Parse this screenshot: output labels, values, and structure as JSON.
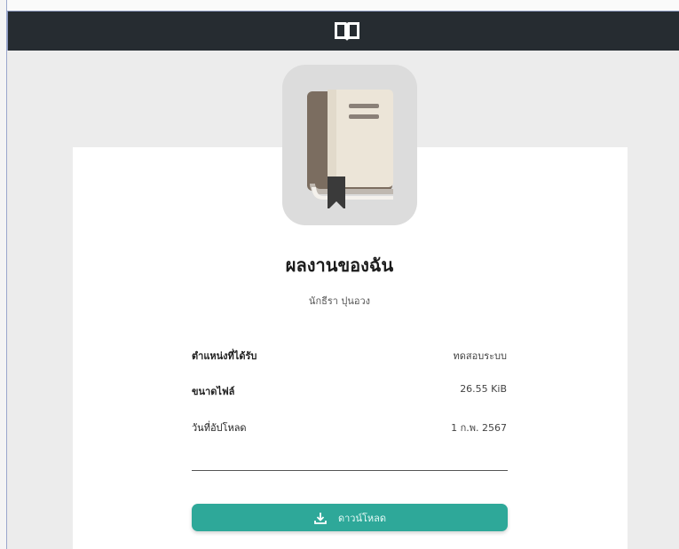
{
  "header": {
    "logo_icon": "open-book-icon",
    "bar_color": "#262c31"
  },
  "document": {
    "cover_icon": "book-with-bookmark-icon",
    "title": "ผลงานของฉัน",
    "author": "นักธีรา ปุนอวง"
  },
  "details": [
    {
      "label": "ตำแหน่งที่ได้รับ",
      "value": "ทดสอบระบบ"
    },
    {
      "label": "ขนาดไฟล์",
      "value": "26.55 KiB"
    },
    {
      "label": "วันที่อัปโหลด",
      "value": "1 ก.พ. 2567"
    }
  ],
  "actions": {
    "download_label": "ดาวน์โหลด",
    "download_icon": "download-icon",
    "accent_color": "#2ea899"
  }
}
